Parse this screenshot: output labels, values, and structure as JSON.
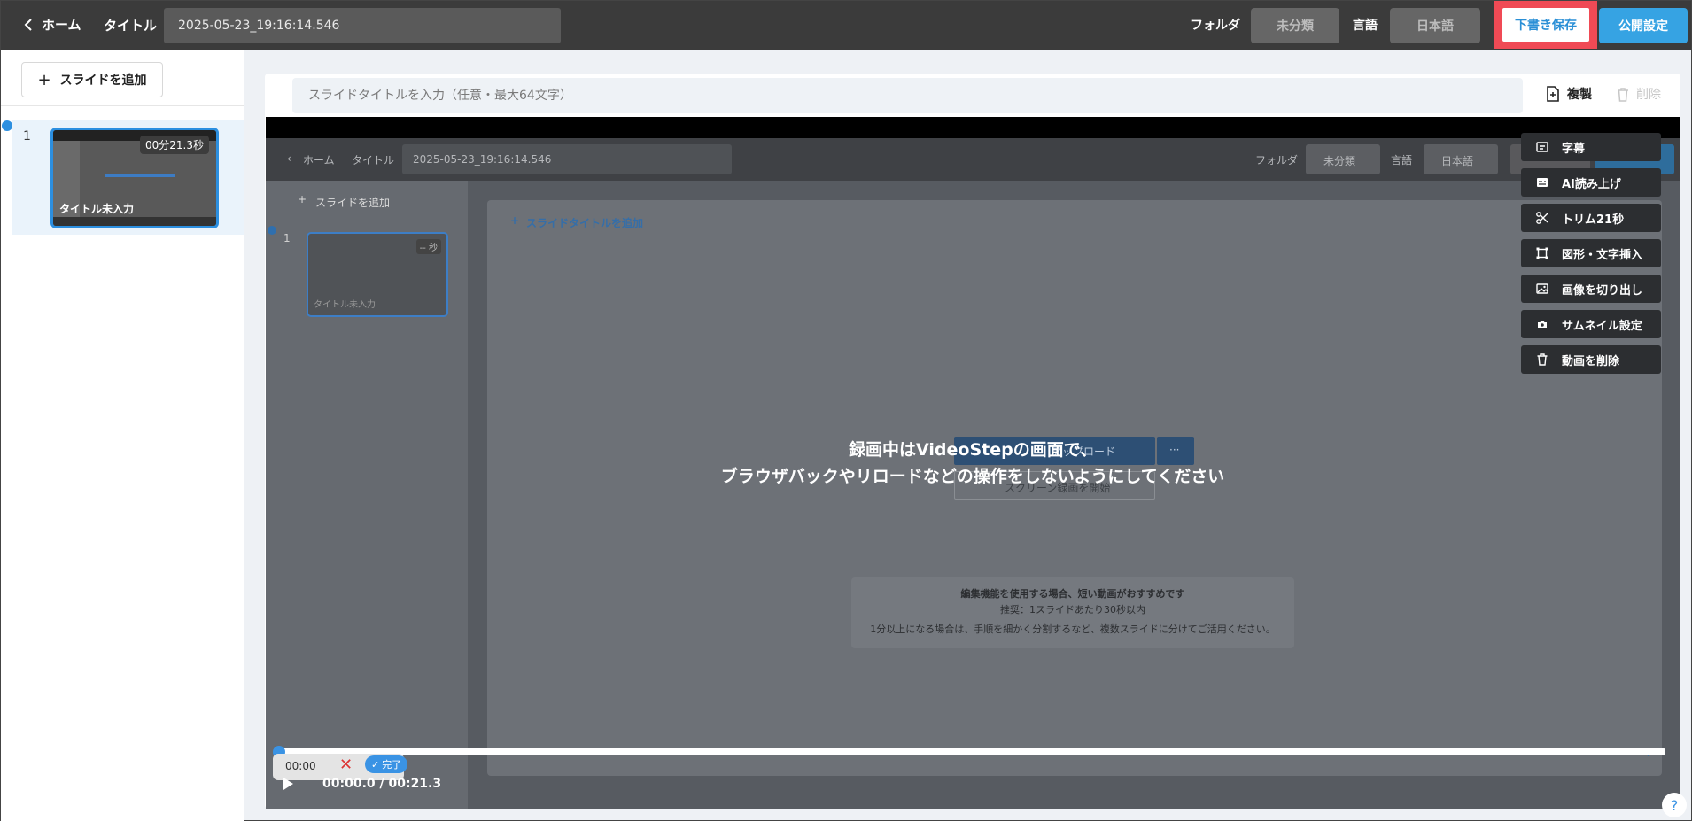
{
  "header": {
    "back_label": "ホーム",
    "title_label": "タイトル",
    "title_value": "2025-05-23_19:16:14.546",
    "folder_label": "フォルダ",
    "folder_value": "未分類",
    "language_label": "言語",
    "language_value": "日本語",
    "draft_save_label": "下書き保存",
    "publish_label": "公開設定"
  },
  "sidebar": {
    "add_slide_label": "スライドを追加",
    "slides": [
      {
        "number": "1",
        "duration": "00分21.3秒",
        "title": "タイトル未入力"
      }
    ]
  },
  "main": {
    "slide_title_placeholder": "スライドタイトルを入力（任意・最大64文字）",
    "duplicate_label": "複製",
    "delete_label": "削除"
  },
  "video": {
    "overlay_line1": "録画中はVideoStepの画面で、",
    "overlay_line2": "ブラウザバックやリロードなどの操作をしないようにしてください",
    "embedded": {
      "back_label": "ホーム",
      "title_label": "タイトル",
      "title_value": "2025-05-23_19:16:14.546",
      "folder_label": "フォルダ",
      "folder_value": "未分類",
      "language_label": "言語",
      "language_value": "日本語",
      "add_slide_label": "スライドを追加",
      "add_slide_title_label": "スライドタイトルを追加",
      "slide_number": "1",
      "slide_duration": "-- 秒",
      "slide_title": "タイトル未入力",
      "upload_label": "アップロード",
      "more_label": "···",
      "screen_record_label": "スクリーン録画を開始",
      "note_line1": "編集機能を使用する場合、短い動画がおすすめです",
      "note_line2": "推奨：1スライドあたり30秒以内",
      "note_line3": "1分以上になる場合は、手順を細かく分割するなど、複数スライドに分けてご活用ください。",
      "help_label": "?"
    },
    "tools": [
      {
        "label": "字幕",
        "icon": "subtitle-icon"
      },
      {
        "label": "AI読み上げ",
        "icon": "ai-voice-icon"
      },
      {
        "label": "トリム21秒",
        "icon": "scissors-icon"
      },
      {
        "label": "図形・文字挿入",
        "icon": "shape-icon"
      },
      {
        "label": "画像を切り出し",
        "icon": "image-icon"
      },
      {
        "label": "サムネイル設定",
        "icon": "camera-icon"
      },
      {
        "label": "動画を削除",
        "icon": "trash-icon"
      }
    ],
    "trim_time": "00:00",
    "trim_done_label": "完了",
    "time_readout": "00:00.0 / 00:21.3",
    "progress_fraction": 0
  },
  "help_label": "?",
  "colors": {
    "accent": "#3a93e4",
    "draft_highlight": "#f04a55",
    "topbar": "#3b3b3b"
  }
}
